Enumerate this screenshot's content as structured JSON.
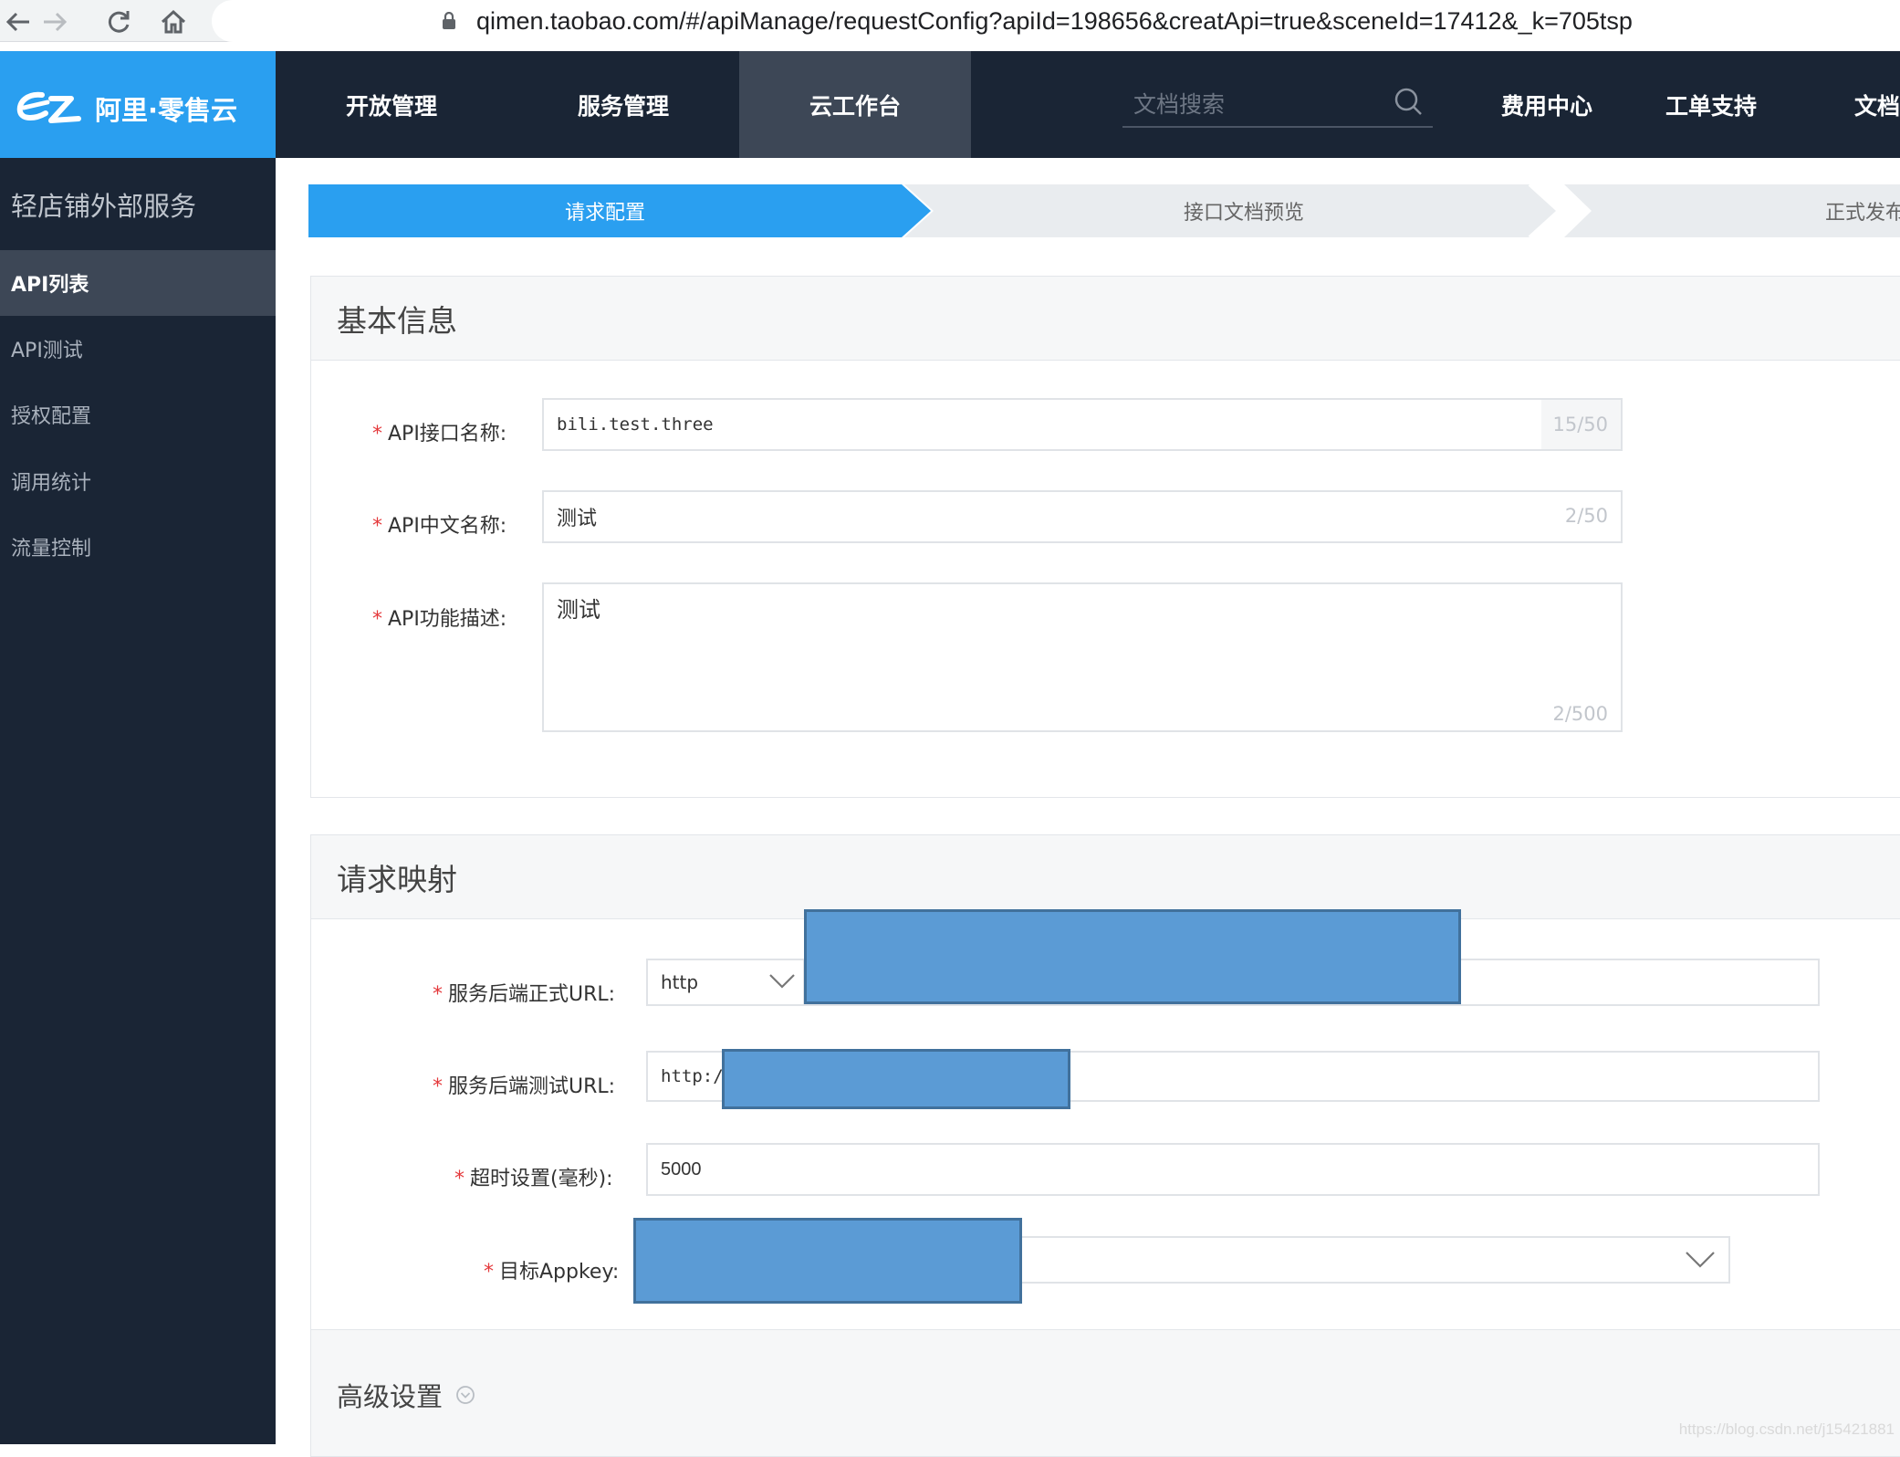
{
  "browser": {
    "url": "qimen.taobao.com/#/apiManage/requestConfig?apiId=198656&creatApi=true&sceneId=17412&_k=705tsp",
    "back_icon": "arrow-left-icon",
    "forward_icon": "arrow-right-icon",
    "reload_icon": "reload-icon",
    "home_icon": "home-icon"
  },
  "header": {
    "logo_text": "阿里·零售云",
    "nav": [
      "开放管理",
      "服务管理",
      "云工作台"
    ],
    "active_nav": "云工作台",
    "search_placeholder": "文档搜索",
    "right_nav": [
      "费用中心",
      "工单支持",
      "文档"
    ]
  },
  "sidebar": {
    "title": "轻店铺外部服务",
    "items": [
      "API列表",
      "API测试",
      "授权配置",
      "调用统计",
      "流量控制"
    ],
    "active": "API列表"
  },
  "steps": {
    "items": [
      "请求配置",
      "接口文档预览",
      "正式发布"
    ],
    "active": "请求配置"
  },
  "basic_info": {
    "title": "基本信息",
    "api_name_label": "API接口名称:",
    "api_name_value": "bili.test.three",
    "api_name_count": "15/50",
    "api_cn_label": "API中文名称:",
    "api_cn_value": "测试",
    "api_cn_count": "2/50",
    "api_desc_label": "API功能描述:",
    "api_desc_value": "测试",
    "api_desc_count": "2/500"
  },
  "request_mapping": {
    "title": "请求映射",
    "prod_url_label": "服务后端正式URL:",
    "prod_protocol": "http",
    "test_url_label": "服务后端测试URL:",
    "test_url_value": "http:/",
    "timeout_label": "超时设置(毫秒):",
    "timeout_value": "5000",
    "appkey_label": "目标Appkey:"
  },
  "advanced": {
    "title": "高级设置"
  },
  "watermark": "https://blog.csdn.net/j15421881",
  "colors": {
    "brand": "#2a9ff0",
    "nav_bg": "#1a2535",
    "required": "#e4393c",
    "redaction": "#5b9bd5"
  }
}
